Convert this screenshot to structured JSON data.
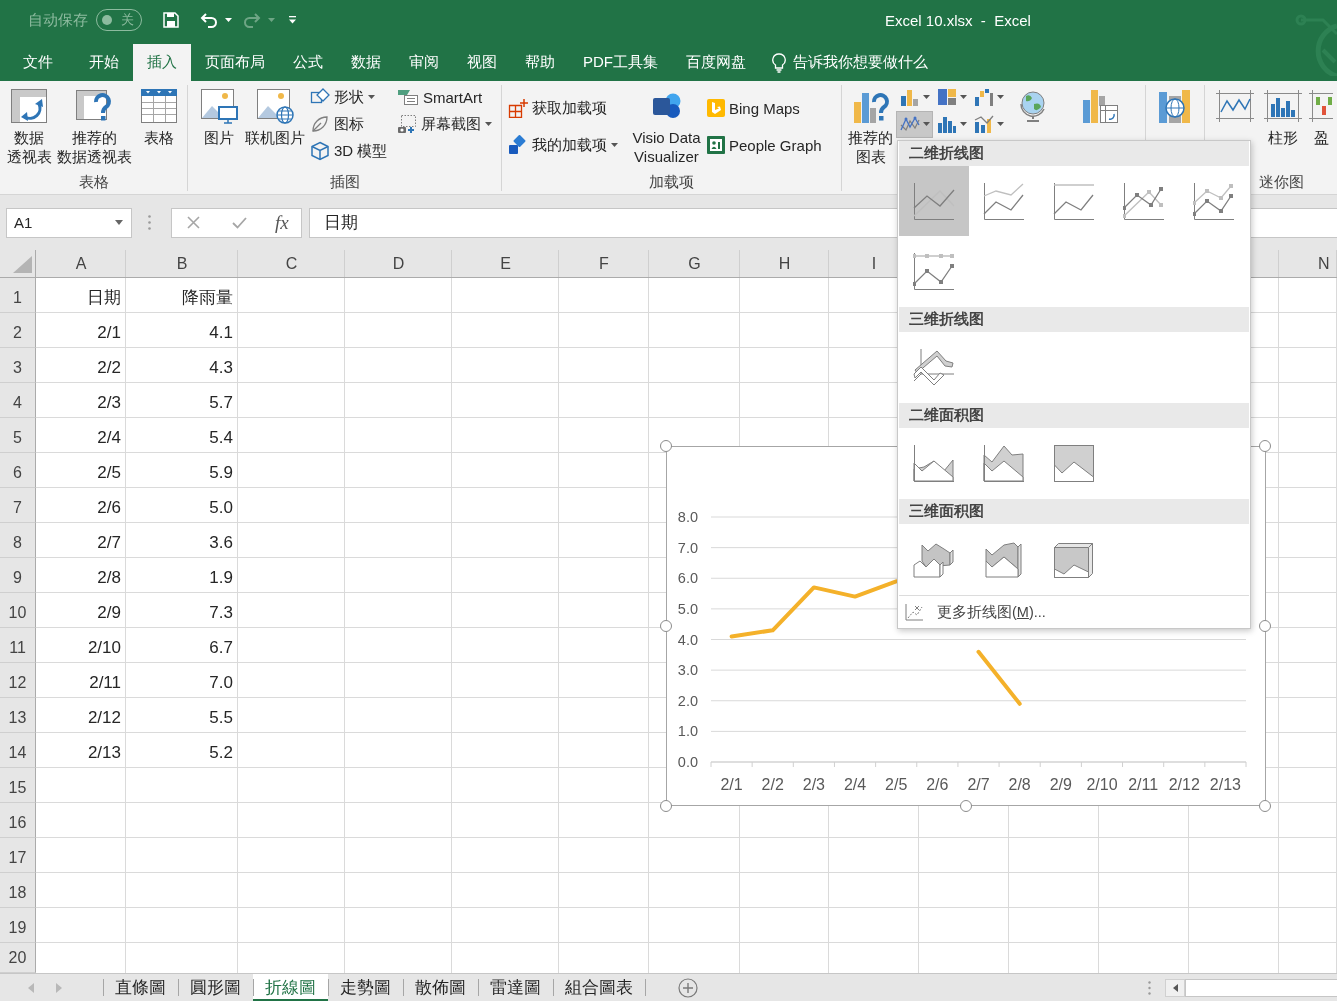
{
  "title_bar": {
    "autosave": {
      "label": "自动保存",
      "state_text": "关",
      "on": false
    },
    "quick_access": [
      {
        "kind": "save",
        "disabled": false
      },
      {
        "kind": "undo",
        "disabled": false
      },
      {
        "kind": "redo",
        "disabled": true
      },
      {
        "kind": "customize",
        "disabled": false
      }
    ],
    "title": "Excel 10.xlsx  -  Excel"
  },
  "menu_tabs": [
    {
      "label": "文件",
      "selected": false
    },
    {
      "label": "开始",
      "selected": false
    },
    {
      "label": "插入",
      "selected": true
    },
    {
      "label": "页面布局",
      "selected": false
    },
    {
      "label": "公式",
      "selected": false
    },
    {
      "label": "数据",
      "selected": false
    },
    {
      "label": "审阅",
      "selected": false
    },
    {
      "label": "视图",
      "selected": false
    },
    {
      "label": "帮助",
      "selected": false
    },
    {
      "label": "PDF工具集",
      "selected": false
    },
    {
      "label": "百度网盘",
      "selected": false
    }
  ],
  "tell_me": "告诉我你想要做什么",
  "ribbon": {
    "groups": [
      {
        "label": "表格",
        "columns": [
          {
            "kind": "large",
            "lines": [
              "数据",
              "透视表"
            ]
          },
          {
            "kind": "large",
            "lines": [
              "推荐的",
              "数据透视表"
            ]
          },
          {
            "kind": "large",
            "lines": [
              "表格"
            ]
          }
        ]
      },
      {
        "label": "插图",
        "columns": [
          {
            "kind": "large",
            "lines": [
              "图片"
            ]
          },
          {
            "kind": "large",
            "lines": [
              "联机图片"
            ]
          },
          {
            "kind": "stack",
            "buttons": [
              {
                "label": "形状",
                "dropdown": true
              },
              {
                "label": "图标",
                "dropdown": false
              },
              {
                "label": "3D 模型",
                "dropdown": false
              }
            ]
          },
          {
            "kind": "stack",
            "buttons": [
              {
                "label": "SmartArt",
                "dropdown": false
              },
              {
                "label": "屏幕截图",
                "dropdown": true
              }
            ]
          }
        ]
      },
      {
        "label": "加载项",
        "columns": [
          {
            "kind": "spread",
            "buttons": [
              {
                "label": "获取加载项",
                "dropdown": false
              },
              {
                "label": "我的加载项",
                "dropdown": true
              }
            ]
          },
          {
            "kind": "large",
            "lines": [
              "Visio Data",
              "Visualizer"
            ]
          },
          {
            "kind": "spread",
            "buttons": [
              {
                "label": "Bing Maps",
                "dropdown": false
              },
              {
                "label": "People Graph",
                "dropdown": false
              }
            ]
          }
        ]
      },
      {
        "columns": [
          {
            "kind": "large",
            "lines": [
              "推荐的",
              "图表"
            ]
          },
          {
            "kind": "grid",
            "buttons": [
              {
                "expanded": false
              },
              {
                "expanded": false
              },
              {
                "expanded": false
              },
              {
                "expanded": true
              },
              {
                "expanded": false
              },
              {
                "expanded": false
              }
            ]
          },
          {
            "kind": "large"
          },
          {
            "kind": "large"
          }
        ]
      },
      {
        "columns": [
          {
            "kind": "large"
          }
        ]
      },
      {
        "label": "迷你图",
        "columns": [
          {
            "kind": "large"
          },
          {
            "kind": "large",
            "lines": [
              "柱形"
            ]
          },
          {
            "kind": "large",
            "lines": [
              "盈"
            ]
          }
        ]
      }
    ]
  },
  "chart_menu": {
    "sections": [
      {
        "title": "二维折线图",
        "items": [
          {
            "kind": "line",
            "selected": true
          },
          {
            "kind": "stacked",
            "selected": false
          },
          {
            "kind": "percent",
            "selected": false
          },
          {
            "kind": "marked",
            "selected": false
          },
          {
            "kind": "stackedmarked",
            "selected": false
          },
          {
            "kind": "percentmarked",
            "selected": false
          }
        ]
      },
      {
        "title": "三维折线图",
        "items": [
          {
            "kind": "line3d",
            "selected": false
          }
        ]
      },
      {
        "title": "二维面积图",
        "items": [
          {
            "kind": "area",
            "selected": false
          },
          {
            "kind": "stackedarea",
            "selected": false
          },
          {
            "kind": "percentarea",
            "selected": false
          }
        ]
      },
      {
        "title": "三维面积图",
        "items": [
          {
            "kind": "area3d",
            "selected": false
          },
          {
            "kind": "stackedarea3d",
            "selected": false
          },
          {
            "kind": "percentarea3d",
            "selected": false
          }
        ]
      }
    ],
    "more": {
      "label": "更多折线图(",
      "accelerator": "M",
      "suffix": ")..."
    }
  },
  "formula_bar": {
    "name_box": "A1",
    "function_label": "fx",
    "value": "日期"
  },
  "sheet": {
    "column_headers": [
      "A",
      "B",
      "C",
      "D",
      "E",
      "F",
      "G",
      "H",
      "I",
      "N"
    ],
    "rows": [
      {
        "header": "1",
        "cells": [
          "日期",
          "降雨量"
        ]
      },
      {
        "header": "2",
        "cells": [
          "2/1",
          "4.1"
        ]
      },
      {
        "header": "3",
        "cells": [
          "2/2",
          "4.3"
        ]
      },
      {
        "header": "4",
        "cells": [
          "2/3",
          "5.7"
        ]
      },
      {
        "header": "5",
        "cells": [
          "2/4",
          "5.4"
        ]
      },
      {
        "header": "6",
        "cells": [
          "2/5",
          "5.9"
        ]
      },
      {
        "header": "7",
        "cells": [
          "2/6",
          "5.0"
        ]
      },
      {
        "header": "8",
        "cells": [
          "2/7",
          "3.6"
        ]
      },
      {
        "header": "9",
        "cells": [
          "2/8",
          "1.9"
        ]
      },
      {
        "header": "10",
        "cells": [
          "2/9",
          "7.3"
        ]
      },
      {
        "header": "11",
        "cells": [
          "2/10",
          "6.7"
        ]
      },
      {
        "header": "12",
        "cells": [
          "2/11",
          "7.0"
        ]
      },
      {
        "header": "13",
        "cells": [
          "2/12",
          "5.5"
        ]
      },
      {
        "header": "14",
        "cells": [
          "2/13",
          "5.2"
        ]
      },
      {
        "header": "15"
      },
      {
        "header": "16"
      },
      {
        "header": "17"
      },
      {
        "header": "18"
      },
      {
        "header": "19"
      },
      {
        "header": "20"
      }
    ]
  },
  "chart": {
    "selected": true,
    "chart_data": {
      "type": "line",
      "categories": [
        "2/1",
        "2/2",
        "2/3",
        "2/4",
        "2/5",
        "2/6",
        "2/7",
        "2/8",
        "2/9",
        "2/10",
        "2/11",
        "2/12",
        "2/13"
      ],
      "values": [
        4.1,
        4.3,
        5.7,
        5.4,
        5.9,
        null,
        3.6,
        1.9,
        null,
        null,
        null,
        null,
        null
      ],
      "color": "#f4b12a",
      "ylim": [
        0,
        8
      ],
      "yticks": [
        {
          "value": 0,
          "label": "0.0"
        },
        {
          "value": 1,
          "label": "1.0"
        },
        {
          "value": 2,
          "label": "2.0"
        },
        {
          "value": 3,
          "label": "3.0"
        },
        {
          "value": 4,
          "label": "4.0"
        },
        {
          "value": 5,
          "label": "5.0"
        },
        {
          "value": 6,
          "label": "6.0"
        },
        {
          "value": 7,
          "label": "7.0"
        },
        {
          "value": 8,
          "label": "8.0"
        }
      ],
      "grid": true
    }
  },
  "sheet_tabs": [
    {
      "label": "直條圖",
      "selected": false
    },
    {
      "label": "圓形圖",
      "selected": false
    },
    {
      "label": "折線圖",
      "selected": true
    },
    {
      "label": "走勢圖",
      "selected": false
    },
    {
      "label": "散佈圖",
      "selected": false
    },
    {
      "label": "雷達圖",
      "selected": false
    },
    {
      "label": "組合圖表",
      "selected": false
    }
  ]
}
